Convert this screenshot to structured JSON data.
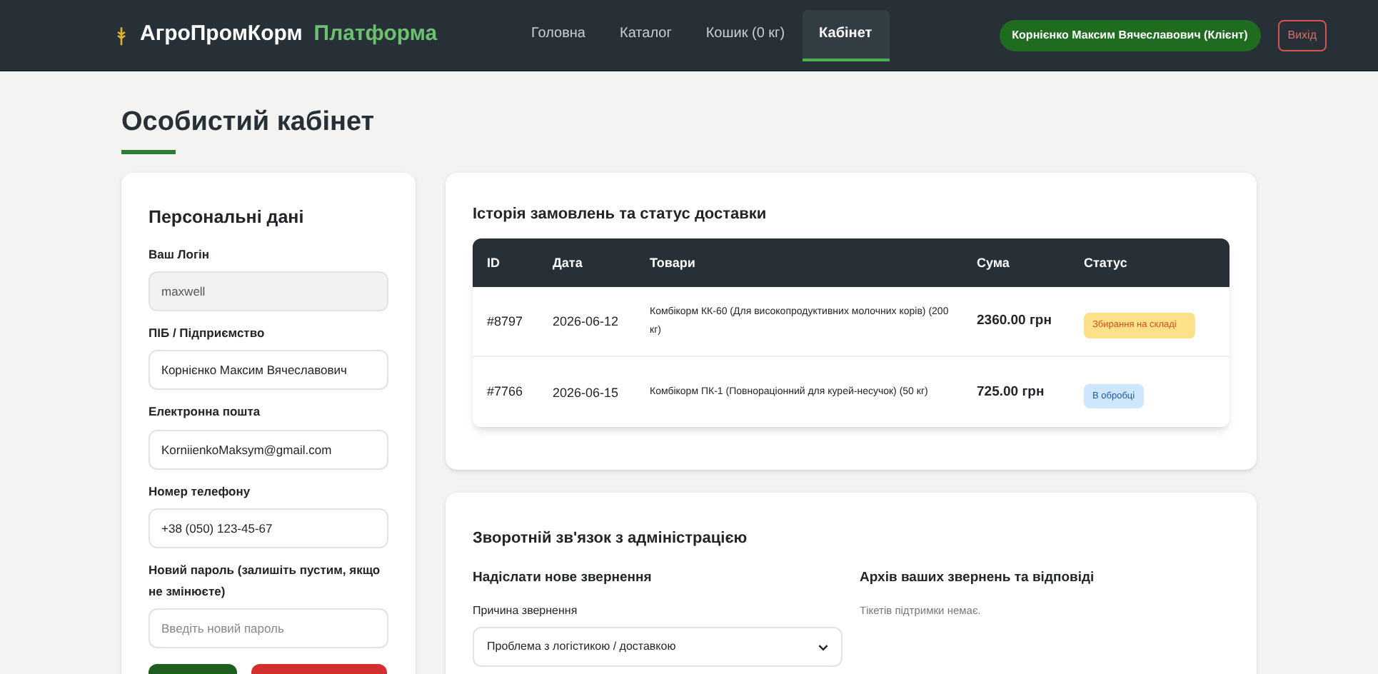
{
  "brand": {
    "name": "АгроПромКорм",
    "suffix": "Платформа"
  },
  "nav": [
    {
      "label": "Головна",
      "selected": false
    },
    {
      "label": "Каталог",
      "selected": false
    },
    {
      "label": "Кошик (0 кг)",
      "selected": false
    },
    {
      "label": "Кабінет",
      "selected": true
    }
  ],
  "user": "Корнієнко Максим Вячеславович (Клієнт)",
  "logout": "Вихід",
  "page_title": "Особистий кабінет",
  "profile": {
    "title": "Персональні дані",
    "fields": [
      {
        "label": "Ваш Логін",
        "value": "maxwell",
        "disabled": true
      },
      {
        "label": "ПІБ / Підприємство",
        "value": "Корнієнко Максим Вячеславович",
        "disabled": false
      },
      {
        "label": "Електронна пошта",
        "value": "KorniienkoMaksym@gmail.com",
        "disabled": false
      },
      {
        "label": "Номер телефону",
        "value": "+38 (050) 123-45-67",
        "disabled": false
      },
      {
        "label": "Новий пароль (залишіть пустим, якщо не змінюєте)",
        "placeholder": "Введіть новий пароль",
        "disabled": false
      }
    ],
    "buttons": [
      {
        "kind": "primary"
      },
      {
        "kind": "danger"
      }
    ]
  },
  "orders": {
    "title": "Історія замовлень та статус доставки",
    "columns": [
      "ID",
      "Дата",
      "Товари",
      "Сума",
      "Статус"
    ],
    "rows": [
      {
        "id": "#8797",
        "date": "2026-06-12",
        "items": "Комбікорм КК-60 (Для високопродуктивних молочних корів) (200 кг)",
        "sum": "2360.00 грн",
        "status": "Збирання на складі",
        "kind": "warning"
      },
      {
        "id": "#7766",
        "date": "2026-06-15",
        "items": "Комбікорм ПК-1 (Повнораціонний для курей-несучок) (50 кг)",
        "sum": "725.00 грн",
        "status": "В обробці",
        "kind": "info"
      }
    ]
  },
  "feedback": {
    "title": "Зворотній зв'язок з адміністрацією",
    "new_title": "Надіслати нове звернення",
    "reason_label": "Причина звернення",
    "reason_value": "Проблема з логістикою / доставкою",
    "archive_title": "Архів ваших звернень та відповіді",
    "archive_empty": "Тікетів підтримки немає."
  }
}
